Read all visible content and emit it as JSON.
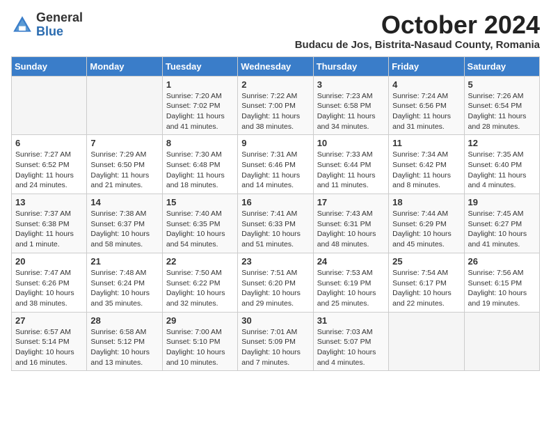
{
  "header": {
    "logo_general": "General",
    "logo_blue": "Blue",
    "month_title": "October 2024",
    "subtitle": "Budacu de Jos, Bistrita-Nasaud County, Romania"
  },
  "days_of_week": [
    "Sunday",
    "Monday",
    "Tuesday",
    "Wednesday",
    "Thursday",
    "Friday",
    "Saturday"
  ],
  "weeks": [
    [
      {
        "day": "",
        "detail": ""
      },
      {
        "day": "",
        "detail": ""
      },
      {
        "day": "1",
        "detail": "Sunrise: 7:20 AM\nSunset: 7:02 PM\nDaylight: 11 hours and 41 minutes."
      },
      {
        "day": "2",
        "detail": "Sunrise: 7:22 AM\nSunset: 7:00 PM\nDaylight: 11 hours and 38 minutes."
      },
      {
        "day": "3",
        "detail": "Sunrise: 7:23 AM\nSunset: 6:58 PM\nDaylight: 11 hours and 34 minutes."
      },
      {
        "day": "4",
        "detail": "Sunrise: 7:24 AM\nSunset: 6:56 PM\nDaylight: 11 hours and 31 minutes."
      },
      {
        "day": "5",
        "detail": "Sunrise: 7:26 AM\nSunset: 6:54 PM\nDaylight: 11 hours and 28 minutes."
      }
    ],
    [
      {
        "day": "6",
        "detail": "Sunrise: 7:27 AM\nSunset: 6:52 PM\nDaylight: 11 hours and 24 minutes."
      },
      {
        "day": "7",
        "detail": "Sunrise: 7:29 AM\nSunset: 6:50 PM\nDaylight: 11 hours and 21 minutes."
      },
      {
        "day": "8",
        "detail": "Sunrise: 7:30 AM\nSunset: 6:48 PM\nDaylight: 11 hours and 18 minutes."
      },
      {
        "day": "9",
        "detail": "Sunrise: 7:31 AM\nSunset: 6:46 PM\nDaylight: 11 hours and 14 minutes."
      },
      {
        "day": "10",
        "detail": "Sunrise: 7:33 AM\nSunset: 6:44 PM\nDaylight: 11 hours and 11 minutes."
      },
      {
        "day": "11",
        "detail": "Sunrise: 7:34 AM\nSunset: 6:42 PM\nDaylight: 11 hours and 8 minutes."
      },
      {
        "day": "12",
        "detail": "Sunrise: 7:35 AM\nSunset: 6:40 PM\nDaylight: 11 hours and 4 minutes."
      }
    ],
    [
      {
        "day": "13",
        "detail": "Sunrise: 7:37 AM\nSunset: 6:38 PM\nDaylight: 11 hours and 1 minute."
      },
      {
        "day": "14",
        "detail": "Sunrise: 7:38 AM\nSunset: 6:37 PM\nDaylight: 10 hours and 58 minutes."
      },
      {
        "day": "15",
        "detail": "Sunrise: 7:40 AM\nSunset: 6:35 PM\nDaylight: 10 hours and 54 minutes."
      },
      {
        "day": "16",
        "detail": "Sunrise: 7:41 AM\nSunset: 6:33 PM\nDaylight: 10 hours and 51 minutes."
      },
      {
        "day": "17",
        "detail": "Sunrise: 7:43 AM\nSunset: 6:31 PM\nDaylight: 10 hours and 48 minutes."
      },
      {
        "day": "18",
        "detail": "Sunrise: 7:44 AM\nSunset: 6:29 PM\nDaylight: 10 hours and 45 minutes."
      },
      {
        "day": "19",
        "detail": "Sunrise: 7:45 AM\nSunset: 6:27 PM\nDaylight: 10 hours and 41 minutes."
      }
    ],
    [
      {
        "day": "20",
        "detail": "Sunrise: 7:47 AM\nSunset: 6:26 PM\nDaylight: 10 hours and 38 minutes."
      },
      {
        "day": "21",
        "detail": "Sunrise: 7:48 AM\nSunset: 6:24 PM\nDaylight: 10 hours and 35 minutes."
      },
      {
        "day": "22",
        "detail": "Sunrise: 7:50 AM\nSunset: 6:22 PM\nDaylight: 10 hours and 32 minutes."
      },
      {
        "day": "23",
        "detail": "Sunrise: 7:51 AM\nSunset: 6:20 PM\nDaylight: 10 hours and 29 minutes."
      },
      {
        "day": "24",
        "detail": "Sunrise: 7:53 AM\nSunset: 6:19 PM\nDaylight: 10 hours and 25 minutes."
      },
      {
        "day": "25",
        "detail": "Sunrise: 7:54 AM\nSunset: 6:17 PM\nDaylight: 10 hours and 22 minutes."
      },
      {
        "day": "26",
        "detail": "Sunrise: 7:56 AM\nSunset: 6:15 PM\nDaylight: 10 hours and 19 minutes."
      }
    ],
    [
      {
        "day": "27",
        "detail": "Sunrise: 6:57 AM\nSunset: 5:14 PM\nDaylight: 10 hours and 16 minutes."
      },
      {
        "day": "28",
        "detail": "Sunrise: 6:58 AM\nSunset: 5:12 PM\nDaylight: 10 hours and 13 minutes."
      },
      {
        "day": "29",
        "detail": "Sunrise: 7:00 AM\nSunset: 5:10 PM\nDaylight: 10 hours and 10 minutes."
      },
      {
        "day": "30",
        "detail": "Sunrise: 7:01 AM\nSunset: 5:09 PM\nDaylight: 10 hours and 7 minutes."
      },
      {
        "day": "31",
        "detail": "Sunrise: 7:03 AM\nSunset: 5:07 PM\nDaylight: 10 hours and 4 minutes."
      },
      {
        "day": "",
        "detail": ""
      },
      {
        "day": "",
        "detail": ""
      }
    ]
  ]
}
